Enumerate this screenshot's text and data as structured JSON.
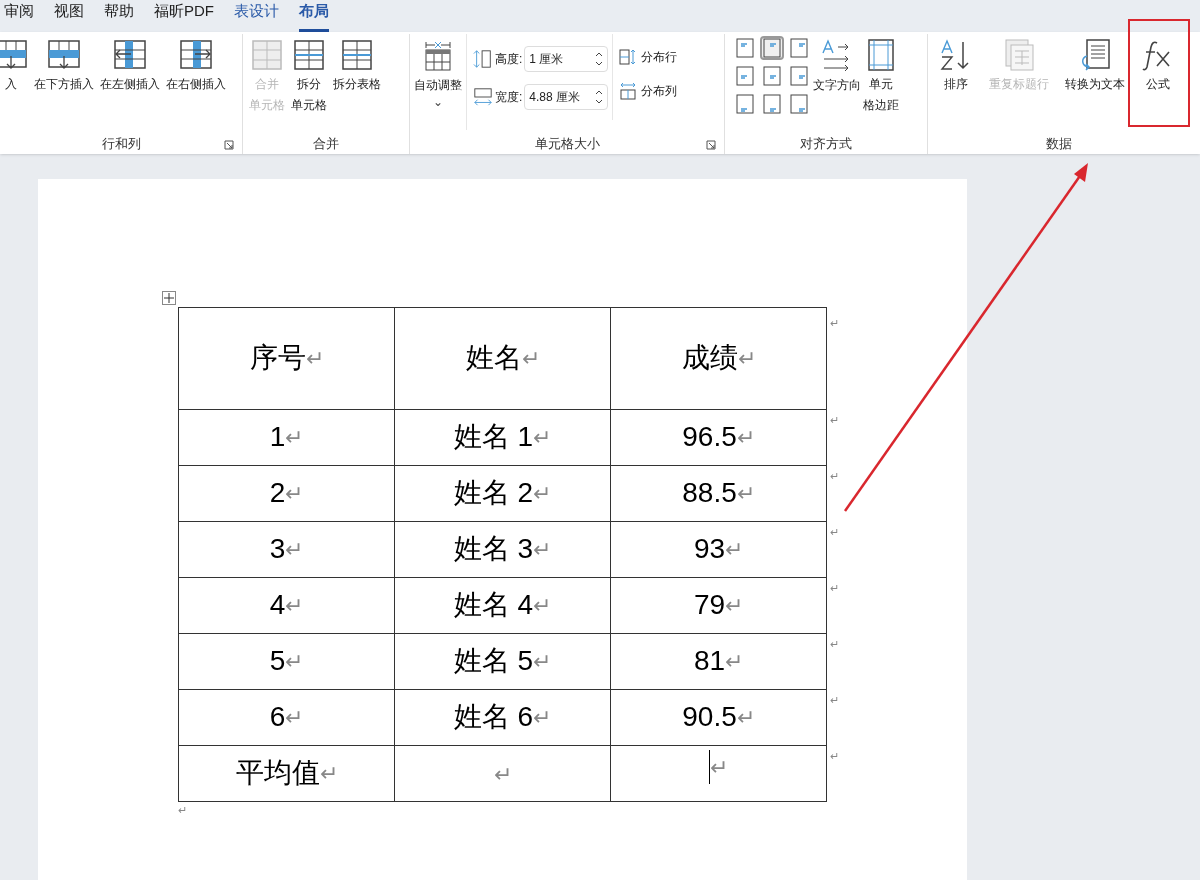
{
  "menu_tabs": [
    {
      "label": "审阅",
      "kind": "normal",
      "selected": false
    },
    {
      "label": "视图",
      "kind": "normal",
      "selected": false
    },
    {
      "label": "帮助",
      "kind": "normal",
      "selected": false
    },
    {
      "label": "福昕PDF",
      "kind": "normal",
      "selected": false
    },
    {
      "label": "表设计",
      "kind": "contextual",
      "selected": false
    },
    {
      "label": "布局",
      "kind": "contextual",
      "selected": true
    }
  ],
  "ribbon": {
    "rows_columns": {
      "title": "行和列",
      "launcher": true,
      "buttons": [
        {
          "label": [
            "入"
          ],
          "kind": "above",
          "disabled": false
        },
        {
          "label": [
            "在下方插入"
          ],
          "kind": "below",
          "disabled": false
        },
        {
          "label": [
            "在左侧插入"
          ],
          "kind": "left",
          "disabled": false
        },
        {
          "label": [
            "在右侧插入"
          ],
          "kind": "right",
          "disabled": false
        }
      ]
    },
    "merge": {
      "title": "合并",
      "buttons": [
        {
          "label": [
            "合并",
            "单元格"
          ],
          "kind": "merge",
          "disabled": true
        },
        {
          "label": [
            "拆分",
            "单元格"
          ],
          "kind": "split",
          "disabled": false
        },
        {
          "label": [
            "拆分表格"
          ],
          "kind": "split_table",
          "disabled": false
        }
      ]
    },
    "cell_size": {
      "title": "单元格大小",
      "launcher": true,
      "autofit": {
        "label": "自动调整",
        "caret": "⌄"
      },
      "height": {
        "label": "高度:",
        "value": "1 厘米"
      },
      "width": {
        "label": "宽度:",
        "value": "4.88 厘米"
      },
      "distribute_rows": "分布行",
      "distribute_columns": "分布列"
    },
    "alignment": {
      "title": "对齐方式",
      "cells": [
        {
          "selected": false
        },
        {
          "selected": true
        },
        {
          "selected": false
        },
        {
          "selected": false
        },
        {
          "selected": false
        },
        {
          "selected": false
        },
        {
          "selected": false
        },
        {
          "selected": false
        },
        {
          "selected": false
        }
      ],
      "text_direction": "文字方向",
      "cell_margins": [
        "单元",
        "格边距"
      ]
    },
    "data": {
      "title": "数据",
      "buttons": [
        {
          "label": [
            "排序"
          ],
          "kind": "sort",
          "disabled": false
        },
        {
          "label": [
            "重复标题行"
          ],
          "kind": "repeat",
          "disabled": true
        },
        {
          "label": [
            "转换为文本"
          ],
          "kind": "convert",
          "disabled": false
        },
        {
          "label": [
            "公式"
          ],
          "kind": "formula",
          "disabled": false,
          "highlighted": true
        }
      ]
    }
  },
  "document": {
    "table": {
      "header": [
        {
          "text": "序号",
          "mark": "↵"
        },
        {
          "text": "姓名",
          "mark": "↵"
        },
        {
          "text": "成绩",
          "mark": "↵"
        }
      ],
      "header_end_mark": "↵",
      "rows": [
        {
          "cells": [
            {
              "text": "1",
              "mark": "↵"
            },
            {
              "text": "姓名 1",
              "mark": "↵"
            },
            {
              "text": "96.5",
              "mark": "↵"
            }
          ],
          "end_mark": "↵"
        },
        {
          "cells": [
            {
              "text": "2",
              "mark": "↵"
            },
            {
              "text": "姓名 2",
              "mark": "↵"
            },
            {
              "text": "88.5",
              "mark": "↵"
            }
          ],
          "end_mark": "↵"
        },
        {
          "cells": [
            {
              "text": "3",
              "mark": "↵"
            },
            {
              "text": "姓名 3",
              "mark": "↵"
            },
            {
              "text": "93",
              "mark": "↵"
            }
          ],
          "end_mark": "↵"
        },
        {
          "cells": [
            {
              "text": "4",
              "mark": "↵"
            },
            {
              "text": "姓名 4",
              "mark": "↵"
            },
            {
              "text": "79",
              "mark": "↵"
            }
          ],
          "end_mark": "↵"
        },
        {
          "cells": [
            {
              "text": "5",
              "mark": "↵"
            },
            {
              "text": "姓名 5",
              "mark": "↵"
            },
            {
              "text": "81",
              "mark": "↵"
            }
          ],
          "end_mark": "↵"
        },
        {
          "cells": [
            {
              "text": "6",
              "mark": "↵"
            },
            {
              "text": "姓名 6",
              "mark": "↵"
            },
            {
              "text": "90.5",
              "mark": "↵"
            }
          ],
          "end_mark": "↵"
        },
        {
          "cells": [
            {
              "text": "平均值",
              "mark": "↵"
            },
            {
              "mark": "↵"
            },
            {
              "mark": "↵",
              "cursor": true
            }
          ],
          "end_mark": "↵"
        }
      ]
    },
    "after_mark": "↵"
  }
}
